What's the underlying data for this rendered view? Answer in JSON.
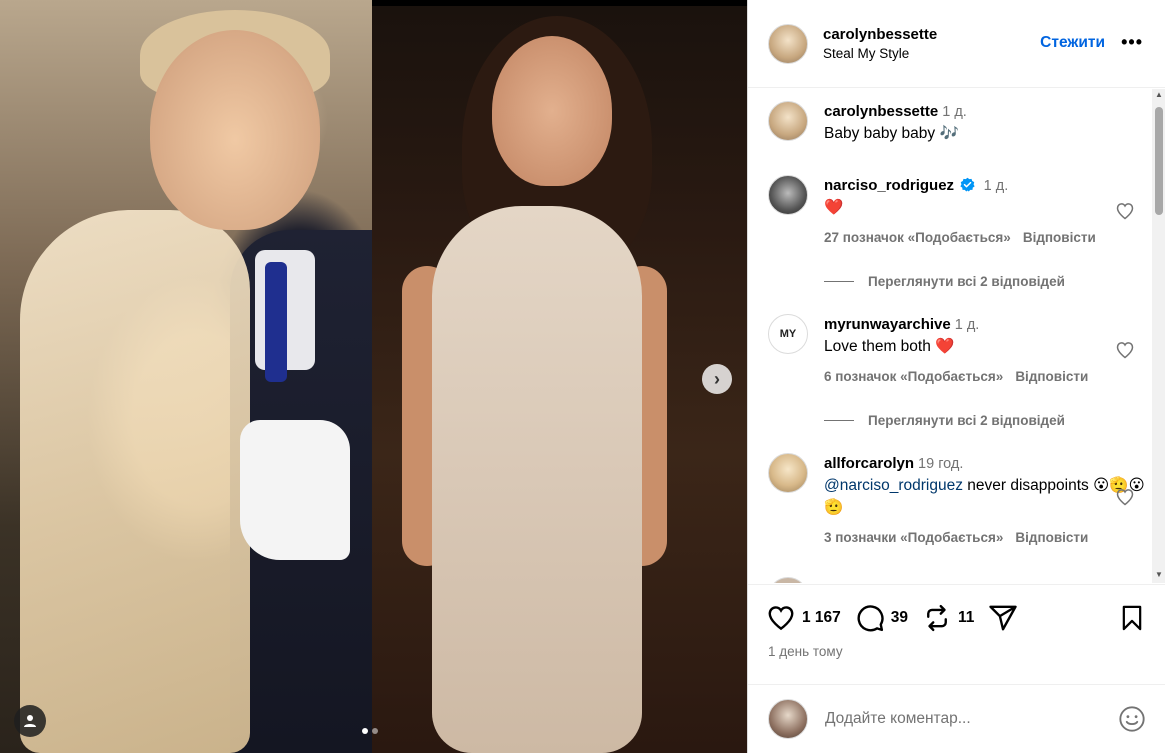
{
  "post": {
    "author": "carolynbessette",
    "subtitle": "Steal My Style",
    "follow_label": "Стежити",
    "more_label": "•••"
  },
  "media": {
    "next_icon": "›",
    "slide_count": 2,
    "current_slide": 1
  },
  "caption": {
    "user": "carolynbessette",
    "time": "1 д.",
    "text": "Baby baby baby 🎶"
  },
  "comments": [
    {
      "user": "narciso_rodriguez",
      "verified": true,
      "time": "1 д.",
      "text": "❤️",
      "likes": "27 позначок «Подобається»",
      "reply_label": "Відповісти",
      "view_replies": "Переглянути всі 2 відповідей"
    },
    {
      "user": "myrunwayarchive",
      "time": "1 д.",
      "text": "Love them both ❤️",
      "likes": "6 позначок «Подобається»",
      "reply_label": "Відповісти",
      "view_replies": "Переглянути всі 2 відповідей",
      "avatar_text": "MY"
    },
    {
      "user": "allforcarolyn",
      "time": "19 год.",
      "mention": "@narciso_rodriguez",
      "text": " never disappoints 😮🫡😮🫡",
      "likes": "3 позначки «Подобається»",
      "reply_label": "Відповісти"
    }
  ],
  "actions": {
    "likes": "1 167",
    "comments": "39",
    "reposts": "11",
    "posted": "1 день тому"
  },
  "add_comment": {
    "placeholder": "Додайте коментар..."
  },
  "colors": {
    "accent": "#0064e0",
    "verified": "#0095f6",
    "heart": "#ed1c24"
  }
}
